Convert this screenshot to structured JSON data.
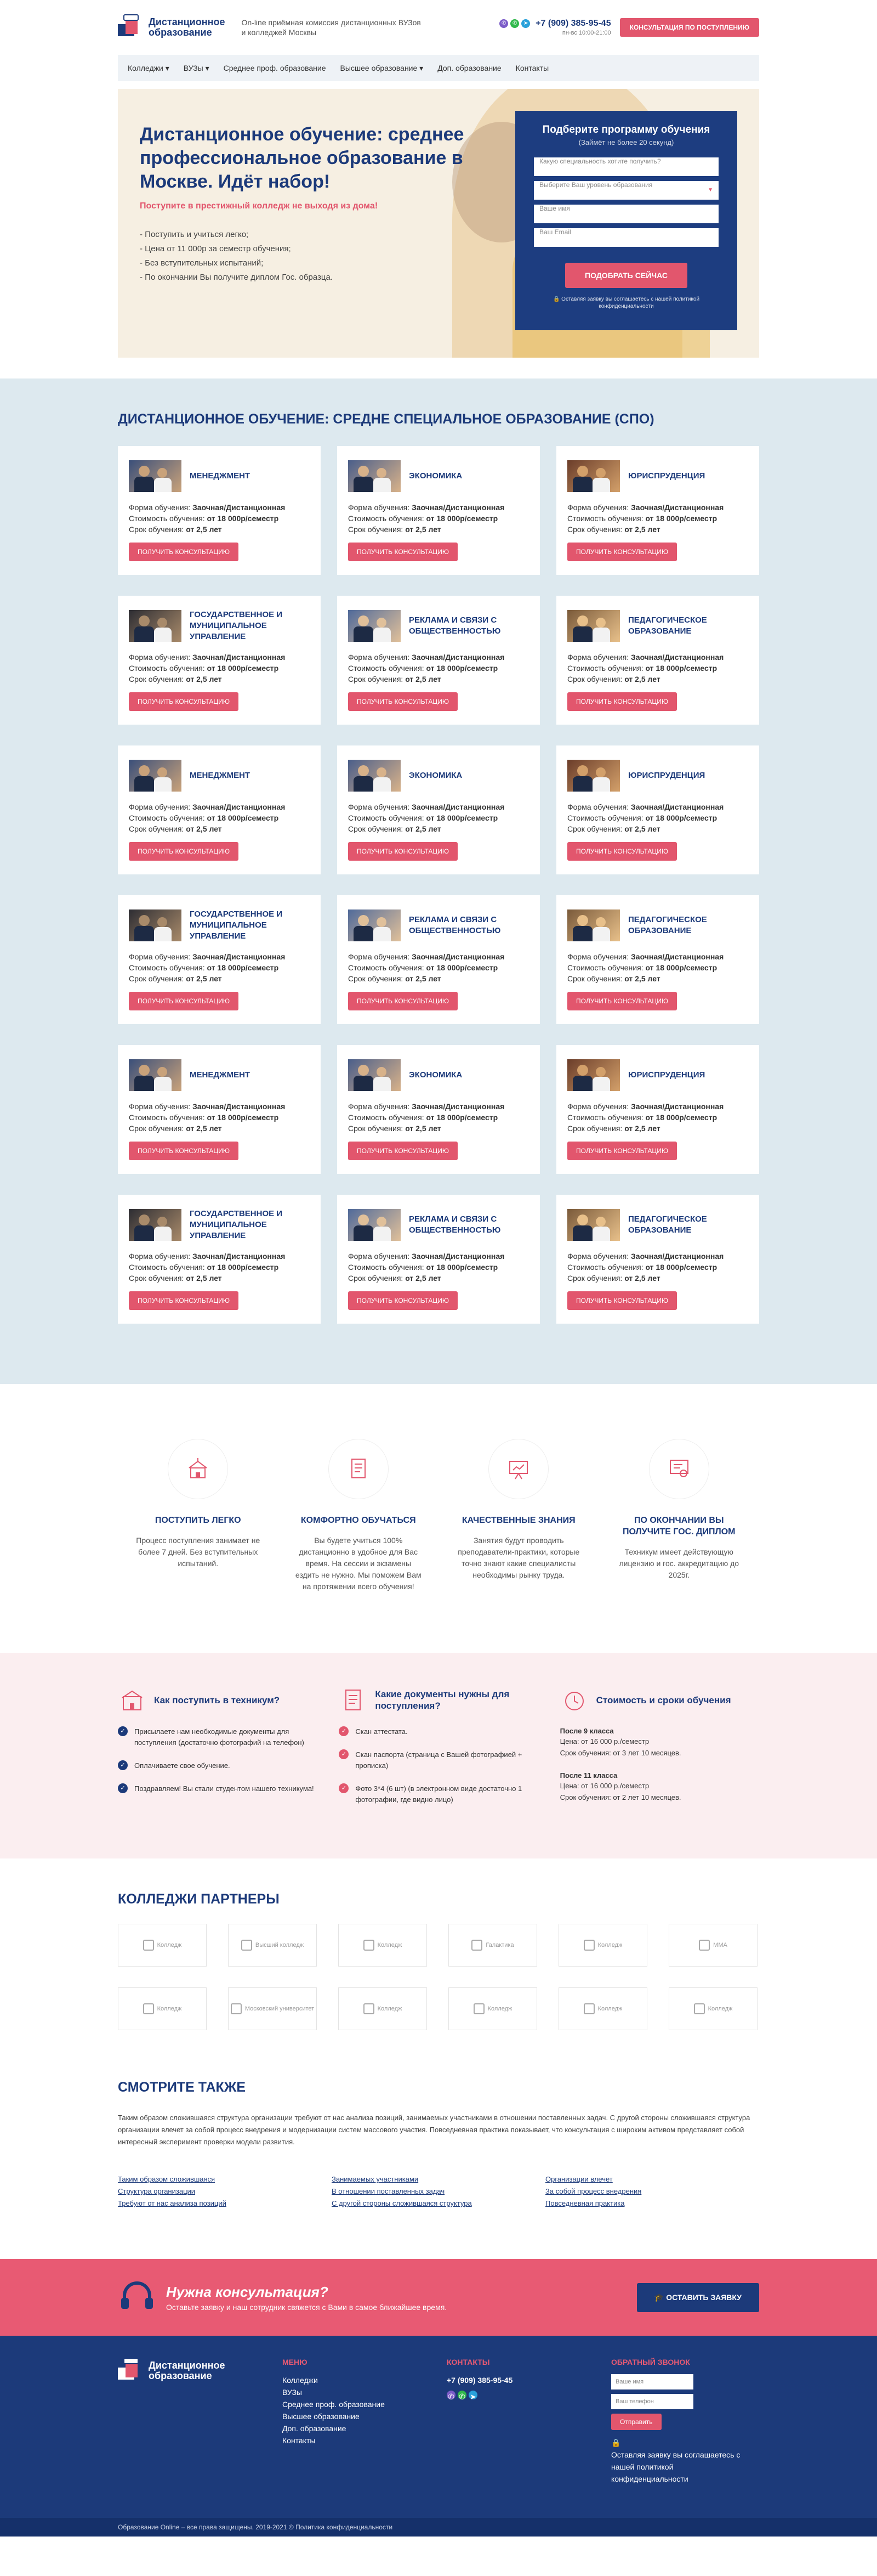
{
  "header": {
    "logo_line1": "Дистанционное",
    "logo_line2": "образование",
    "tagline": "On-line приёмная комиссия дистанционных ВУЗов и колледжей Москвы",
    "phone": "+7 (909) 385-95-45",
    "hours": "пн-вс 10:00-21:00",
    "cta": "Консультация по поступлению"
  },
  "nav": [
    "Колледжи ▾",
    "ВУЗы ▾",
    "Среднее проф. образование",
    "Высшее образование ▾",
    "Доп. образование",
    "Контакты"
  ],
  "hero": {
    "title": "Дистанционное обучение: среднее профессиональное образование в Москве. Идёт набор!",
    "subtitle": "Поступите в престижный колледж не выходя из дома!",
    "bullets": [
      "- Поступить и учиться легко;",
      "- Цена от 11 000р за семестр обучения;",
      "- Без вступительных испытаний;",
      "- По окончании Вы получите диплом Гос. образца."
    ]
  },
  "form": {
    "title": "Подберите программу обучения",
    "subtitle": "(Займёт не более 20 секунд)",
    "spec_placeholder": "Какую специальность хотите получить?",
    "level_placeholder": "Выберите Ваш уровень образования",
    "name_placeholder": "Ваше имя",
    "email_placeholder": "Ваш Email",
    "submit": "Подобрать сейчас",
    "note": "Оставляя заявку вы соглашаетесь с нашей политикой конфиденциальности"
  },
  "spo": {
    "title": "Дистанционное обучение: средне специальное образование (СПО)",
    "form_label": "Форма обучения: ",
    "form_value": "Заочная/Дистанционная",
    "cost_label": "Стоимость обучения: ",
    "cost_value": "от 18 000р/семестр",
    "term_label": "Срок обучения: ",
    "term_value": "от 2,5 лет",
    "button": "Получить консультацию",
    "cards": [
      {
        "title": "Менеджмент"
      },
      {
        "title": "Экономика"
      },
      {
        "title": "Юриспруденция"
      },
      {
        "title": "Государственное и муниципальное управление"
      },
      {
        "title": "Реклама и связи с общественностью"
      },
      {
        "title": "Педагогическое образование"
      },
      {
        "title": "Менеджмент"
      },
      {
        "title": "Экономика"
      },
      {
        "title": "Юриспруденция"
      },
      {
        "title": "Государственное и муниципальное управление"
      },
      {
        "title": "Реклама и связи с общественностью"
      },
      {
        "title": "Педагогическое образование"
      },
      {
        "title": "Менеджмент"
      },
      {
        "title": "Экономика"
      },
      {
        "title": "Юриспруденция"
      },
      {
        "title": "Государственное и муниципальное управление"
      },
      {
        "title": "Реклама и связи с общественностью"
      },
      {
        "title": "Педагогическое образование"
      }
    ]
  },
  "features": [
    {
      "title": "Поступить легко",
      "text": "Процесс поступления занимает не более 7 дней. Без вступительных испытаний."
    },
    {
      "title": "Комфортно обучаться",
      "text": "Вы будете учиться 100% дистанционно в удобное для Вас время. На сессии и экзамены ездить не нужно. Мы поможем Вам на протяжении всего обучения!"
    },
    {
      "title": "Качественные знания",
      "text": "Занятия будут проводить преподаватели-практики, которые точно знают какие специалисты необходимы рынку труда."
    },
    {
      "title": "По окончании Вы получите гос. диплом",
      "text": "Техникум имеет действующую лицензию и гос. аккредитацию до 2025г."
    }
  ],
  "info": {
    "col1_title": "Как поступить в техникум?",
    "col1_items": [
      "Присылаете нам необходимые документы для поступления (достаточно фотографий на телефон)",
      "Оплачиваете свое обучение.",
      "Поздравляем! Вы стали студентом нашего техникума!"
    ],
    "col2_title": "Какие документы нужны для поступления?",
    "col2_items": [
      "Скан  аттестата.",
      "Скан паспорта (страница с Вашей фотографией + прописка)",
      "Фото 3*4 (6 шт) (в электронном виде достаточно 1 фотографии, где видно лицо)"
    ],
    "col3_title": "Стоимость и сроки обучения",
    "p1_title": "После 9 класса",
    "p1_price": "Цена: от 16 000 р./семестр",
    "p1_term": "Срок обучения: от 3 лет 10 месяцев.",
    "p2_title": "После 11 класса",
    "p2_price": "Цена: от 16 000 р./семестр",
    "p2_term": "Срок обучения: от 2 лет 10 месяцев."
  },
  "partners": {
    "title": "Колледжи партнеры",
    "items": [
      "Колледж",
      "Высший колледж",
      "Колледж",
      "Галактика",
      "Колледж",
      "ММА",
      "Колледж",
      "Московский университет",
      "Колледж",
      "Колледж",
      "Колледж",
      "Колледж"
    ]
  },
  "see": {
    "title": "Смотрите также",
    "text": "Таким образом сложившаяся структура организации требуют от нас анализа позиций, занимаемых участниками в отношении поставленных задач. С другой стороны сложившаяся структура организации влечет за собой процесс внедрения и модернизации систем массового участия. Повседневная практика показывает, что консультация с широким активом представляет собой интересный эксперимент проверки модели развития.",
    "links": [
      [
        "Таким образом сложившаяся",
        "Структура организации",
        "Требуют от нас анализа позиций"
      ],
      [
        "Занимаемых участниками",
        "В отношении поставленных задач",
        "С другой стороны сложившаяся структура"
      ],
      [
        "Организации влечет",
        "За собой процесс внедрения",
        "Повседневная практика"
      ]
    ]
  },
  "cta": {
    "title": "Нужна консультация?",
    "text": "Оставьте заявку и наш сотрудник свяжется с Вами в самое ближайшее время.",
    "button": "Оставить заявку"
  },
  "footer": {
    "menu_title": "Меню",
    "menu": [
      "Колледжи",
      "ВУЗы",
      "Среднее проф. образование",
      "Высшее образование",
      "Доп. образование",
      "Контакты"
    ],
    "contacts_title": "Контакты",
    "phone": "+7 (909) 385-95-45",
    "callback_title": "Обратный звонок",
    "name_placeholder": "Ваше имя",
    "phone_placeholder": "Ваш телефон",
    "submit": "Отправить",
    "note": "Оставляя заявку вы соглашаетесь с нашей политикой конфиденциальности",
    "copyright": "Образование Online – все права защищены. 2019-2021 © Политика конфиденциальности"
  },
  "colors": {
    "brand": "#1c3a7a",
    "accent": "#e2566d",
    "section_bg": "#dde9ef",
    "pink_bg": "#fbeef0"
  }
}
